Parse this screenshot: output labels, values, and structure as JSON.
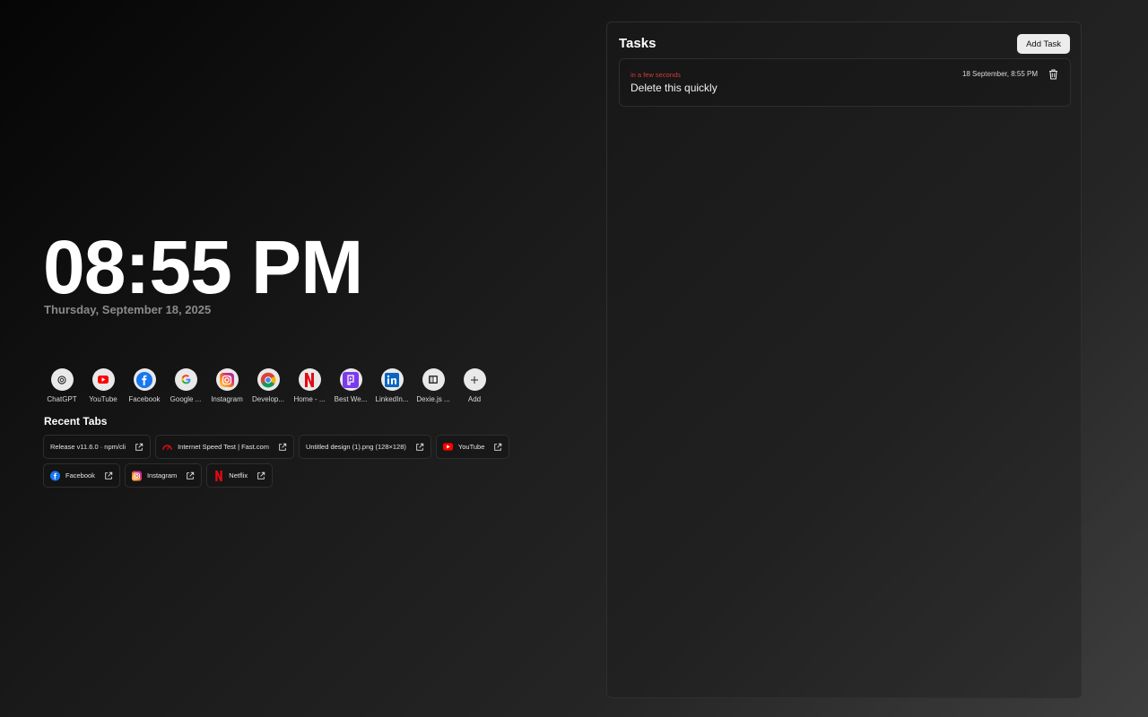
{
  "clock": {
    "time": "08:55 PM",
    "date": "Thursday, September 18, 2025"
  },
  "shortcuts": [
    {
      "label": "ChatGPT",
      "icon": "chatgpt-icon"
    },
    {
      "label": "YouTube",
      "icon": "youtube-icon"
    },
    {
      "label": "Facebook",
      "icon": "facebook-icon"
    },
    {
      "label": "Google ...",
      "icon": "google-icon"
    },
    {
      "label": "Instagram",
      "icon": "instagram-icon"
    },
    {
      "label": "Develop...",
      "icon": "chrome-icon"
    },
    {
      "label": "Home - ...",
      "icon": "netflix-icon"
    },
    {
      "label": "Best We...",
      "icon": "purple-app-icon"
    },
    {
      "label": "LinkedIn...",
      "icon": "linkedin-icon"
    },
    {
      "label": "Dexie.js ...",
      "icon": "dexie-icon"
    },
    {
      "label": "Add",
      "icon": "plus-icon"
    }
  ],
  "recent_tabs": {
    "title": "Recent Tabs",
    "row1": [
      {
        "label": "Release v11.6.0 · npm/cli",
        "icon": "none"
      },
      {
        "label": "Internet Speed Test | Fast.com",
        "icon": "fastcom-icon"
      },
      {
        "label": "Untitled design (1).png (128×128)",
        "icon": "none"
      },
      {
        "label": "YouTube",
        "icon": "youtube-icon"
      }
    ],
    "row2": [
      {
        "label": "Facebook",
        "icon": "facebook-icon"
      },
      {
        "label": "Instagram",
        "icon": "instagram-icon"
      },
      {
        "label": "Netflix",
        "icon": "netflix-icon"
      }
    ]
  },
  "tasks": {
    "title": "Tasks",
    "add_label": "Add Task",
    "items": [
      {
        "due": "in a few seconds",
        "text": "Delete this quickly",
        "timestamp": "18 September, 8:55 PM"
      }
    ]
  },
  "colors": {
    "due_red": "#d33b3b",
    "youtube_red": "#ff0000",
    "facebook_blue": "#1877f2",
    "netflix_red": "#e50914",
    "linkedin_blue": "#0a66c2"
  }
}
